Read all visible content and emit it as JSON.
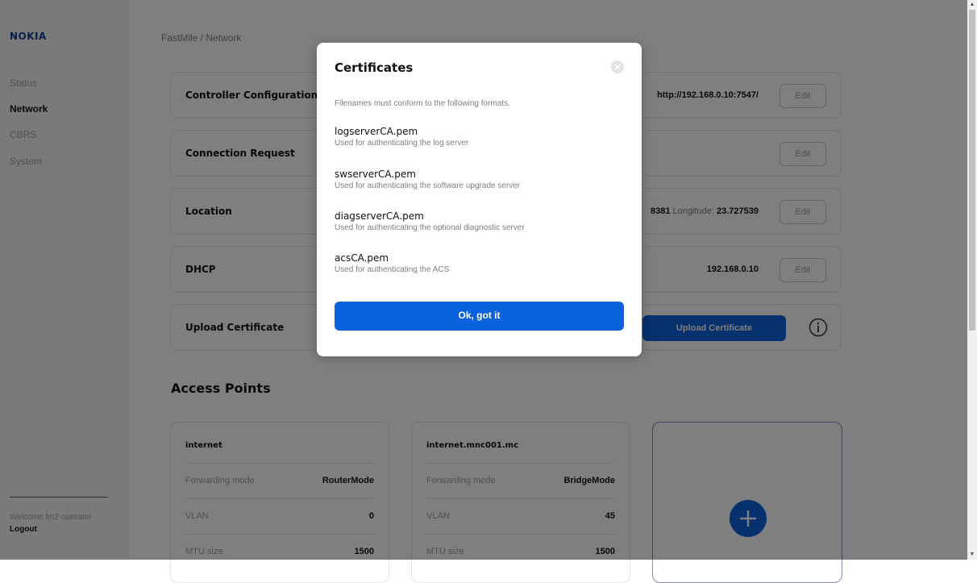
{
  "sidebar": {
    "logo": "NOKIA",
    "items": [
      {
        "label": "Status",
        "active": false
      },
      {
        "label": "Network",
        "active": true
      },
      {
        "label": "CBRS",
        "active": false
      },
      {
        "label": "System",
        "active": false
      }
    ],
    "welcome": "Welcome fm2-operator",
    "logout": "Logout"
  },
  "breadcrumb": "FastMile / Network",
  "cards": {
    "controller": {
      "title": "Controller Configuration",
      "value": "http://192.168.0.10:7547/",
      "edit": "Edit"
    },
    "connection": {
      "title": "Connection Request",
      "edit": "Edit"
    },
    "location": {
      "title": "Location",
      "value_fragment": "8381",
      "longitude_label": "Longitude:",
      "longitude": "23.727539",
      "edit": "Edit"
    },
    "dhcp": {
      "title": "DHCP",
      "value": "192.168.0.10",
      "edit": "Edit"
    },
    "upload": {
      "title": "Upload Certificate",
      "button": "Upload Certificate",
      "info_icon": "info-icon"
    }
  },
  "access_points": {
    "title": "Access Points",
    "items": [
      {
        "name": "internet",
        "rows": [
          {
            "key": "Forwarding mode",
            "value": "RouterMode"
          },
          {
            "key": "VLAN",
            "value": "0"
          },
          {
            "key": "MTU size",
            "value": "1500"
          }
        ]
      },
      {
        "name": "internet.mnc001.mc",
        "rows": [
          {
            "key": "Forwarding mode",
            "value": "BridgeMode"
          },
          {
            "key": "VLAN",
            "value": "45"
          },
          {
            "key": "MTU size",
            "value": "1500"
          }
        ]
      }
    ],
    "add_icon": "plus-icon"
  },
  "modal": {
    "title": "Certificates",
    "close_icon": "close-icon",
    "intro": "Filenames must conform to the following formats.",
    "certs": [
      {
        "name": "logserverCA.pem",
        "desc": "Used for authenticating the log server"
      },
      {
        "name": "swserverCA.pem",
        "desc": "Used for authenticating the software upgrade server"
      },
      {
        "name": "diagserverCA.pem",
        "desc": "Used for authenticating the optional diagnostic server"
      },
      {
        "name": "acsCA.pem",
        "desc": "Used for authenticating the ACS"
      }
    ],
    "ok_button": "Ok, got it"
  },
  "colors": {
    "accent": "#0a63dc",
    "brand": "#124191",
    "overlay": "rgba(0,0,0,0.5)"
  }
}
